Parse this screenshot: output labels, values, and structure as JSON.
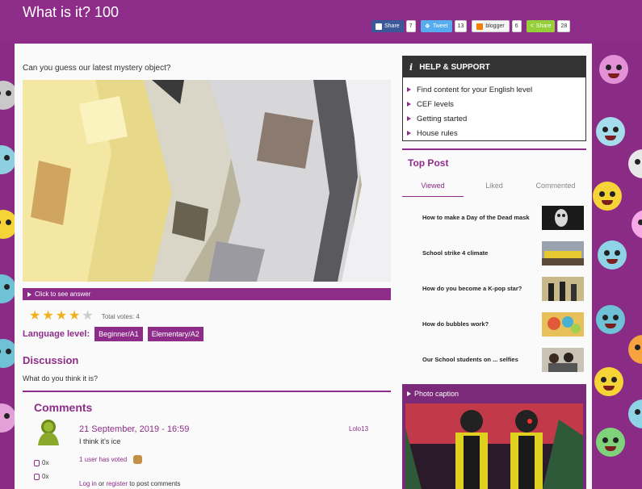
{
  "page": {
    "title": "What is it? 100"
  },
  "share": [
    {
      "label": "Share",
      "count": "7",
      "color": "#3b5998",
      "icon": "facebook-icon"
    },
    {
      "label": "Tweet",
      "count": "13",
      "color": "#55acee",
      "icon": "twitter-icon"
    },
    {
      "label": "blogger",
      "count": "6",
      "color": "#f5f5f5",
      "icon": "blogger-icon"
    },
    {
      "label": "Share",
      "count": "28",
      "color": "#95d03a",
      "icon": "share-icon"
    }
  ],
  "main": {
    "intro": "Can you guess our latest mystery object?",
    "reveal_label": "Click to see answer",
    "rating": {
      "stars_filled": 4,
      "stars_total": 5,
      "votes_text": "Total votes: 4"
    },
    "language_level_label": "Language level:",
    "levels": [
      "Beginner/A1",
      "Elementary/A2"
    ],
    "discussion_heading": "Discussion",
    "discussion_question": "What do you think it is?",
    "comments_heading": "Comments",
    "comment": {
      "date": "21 September, 2019 - 16:59",
      "user": "Lolo13",
      "text": "I think it's ice",
      "voted": "1 user has voted",
      "stat1": "0x",
      "stat2": "0x"
    },
    "login_prefix": "Log in",
    "login_or": " or ",
    "register": "register",
    "login_suffix": " to post comments"
  },
  "sidebar": {
    "help_title": "HELP & SUPPORT",
    "help_items": [
      "Find content for your English level",
      "CEF levels",
      "Getting started",
      "House rules"
    ],
    "top_post_heading": "Top Post",
    "tabs": [
      "Viewed",
      "Liked",
      "Commented"
    ],
    "posts": [
      "How to make a Day of the Dead mask",
      "School strike 4 climate",
      "How do you become a K-pop star?",
      "How do bubbles work?",
      "Our School students on ... selfies"
    ],
    "photo_caption": "Photo caption"
  },
  "colors": {
    "brand": "#8e2d89",
    "star": "#f2b01e"
  }
}
